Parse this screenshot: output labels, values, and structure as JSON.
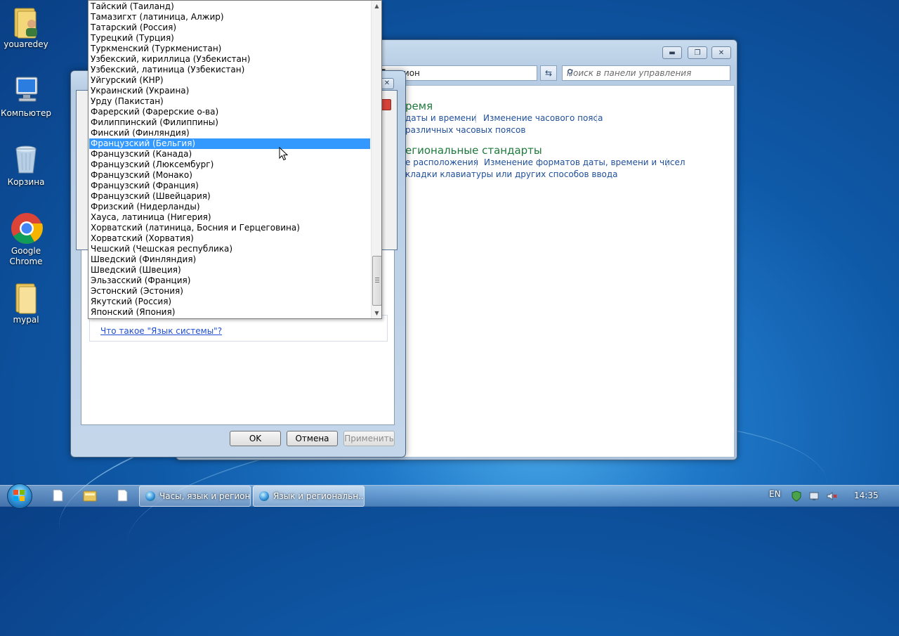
{
  "desktop": {
    "icons": [
      {
        "label": "youaredey"
      },
      {
        "label": "Компьютер"
      },
      {
        "label": "Корзина"
      },
      {
        "label": "Google Chrome"
      },
      {
        "label": "mypal"
      }
    ]
  },
  "control_panel": {
    "address_text": "и регион",
    "search_placeholder": "Поиск в панели управления",
    "section1": {
      "heading": "ремя",
      "link1": "даты и времени",
      "link2": "Изменение часового пояса",
      "link3": "различных часовых поясов"
    },
    "section2": {
      "heading": "егиональные стандарты",
      "link1": "е расположения",
      "link2": "Изменение форматов даты, времени и чисел",
      "link3": "кладки клавиатуры или других способов ввода"
    }
  },
  "dialog": {
    "system_language_link": "Что такое \"Язык системы\"?",
    "ok_label": "OK",
    "cancel_label": "Отмена",
    "apply_label": "Применить"
  },
  "dropdown": {
    "selected_index": 13,
    "items": [
      "Тайский (Таиланд)",
      "Тамазигхт (латиница, Алжир)",
      "Татарский (Россия)",
      "Турецкий (Турция)",
      "Туркменский (Туркменистан)",
      "Узбекский, кириллица (Узбекистан)",
      "Узбекский, латиница (Узбекистан)",
      "Уйгурский (КНР)",
      "Украинский (Украина)",
      "Урду (Пакистан)",
      "Фарерский (Фарерские о-ва)",
      "Филиппинский (Филиппины)",
      "Финский (Финляндия)",
      "Французский (Бельгия)",
      "Французский (Канада)",
      "Французский (Люксембург)",
      "Французский (Монако)",
      "Французский (Франция)",
      "Французский (Швейцария)",
      "Фризский (Нидерланды)",
      "Хауса, латиница (Нигерия)",
      "Хорватский (латиница, Босния и Герцеговина)",
      "Хорватский (Хорватия)",
      "Чешский (Чешская республика)",
      "Шведский (Финляндия)",
      "Шведский (Швеция)",
      "Эльзасский (Франция)",
      "Эстонский (Эстония)",
      "Якутский (Россия)",
      "Японский (Япония)"
    ]
  },
  "taskbar": {
    "tasks": [
      {
        "label": "Часы, язык и регион"
      },
      {
        "label": "Язык и региональн..."
      }
    ],
    "language": "EN",
    "clock": "14:35"
  }
}
